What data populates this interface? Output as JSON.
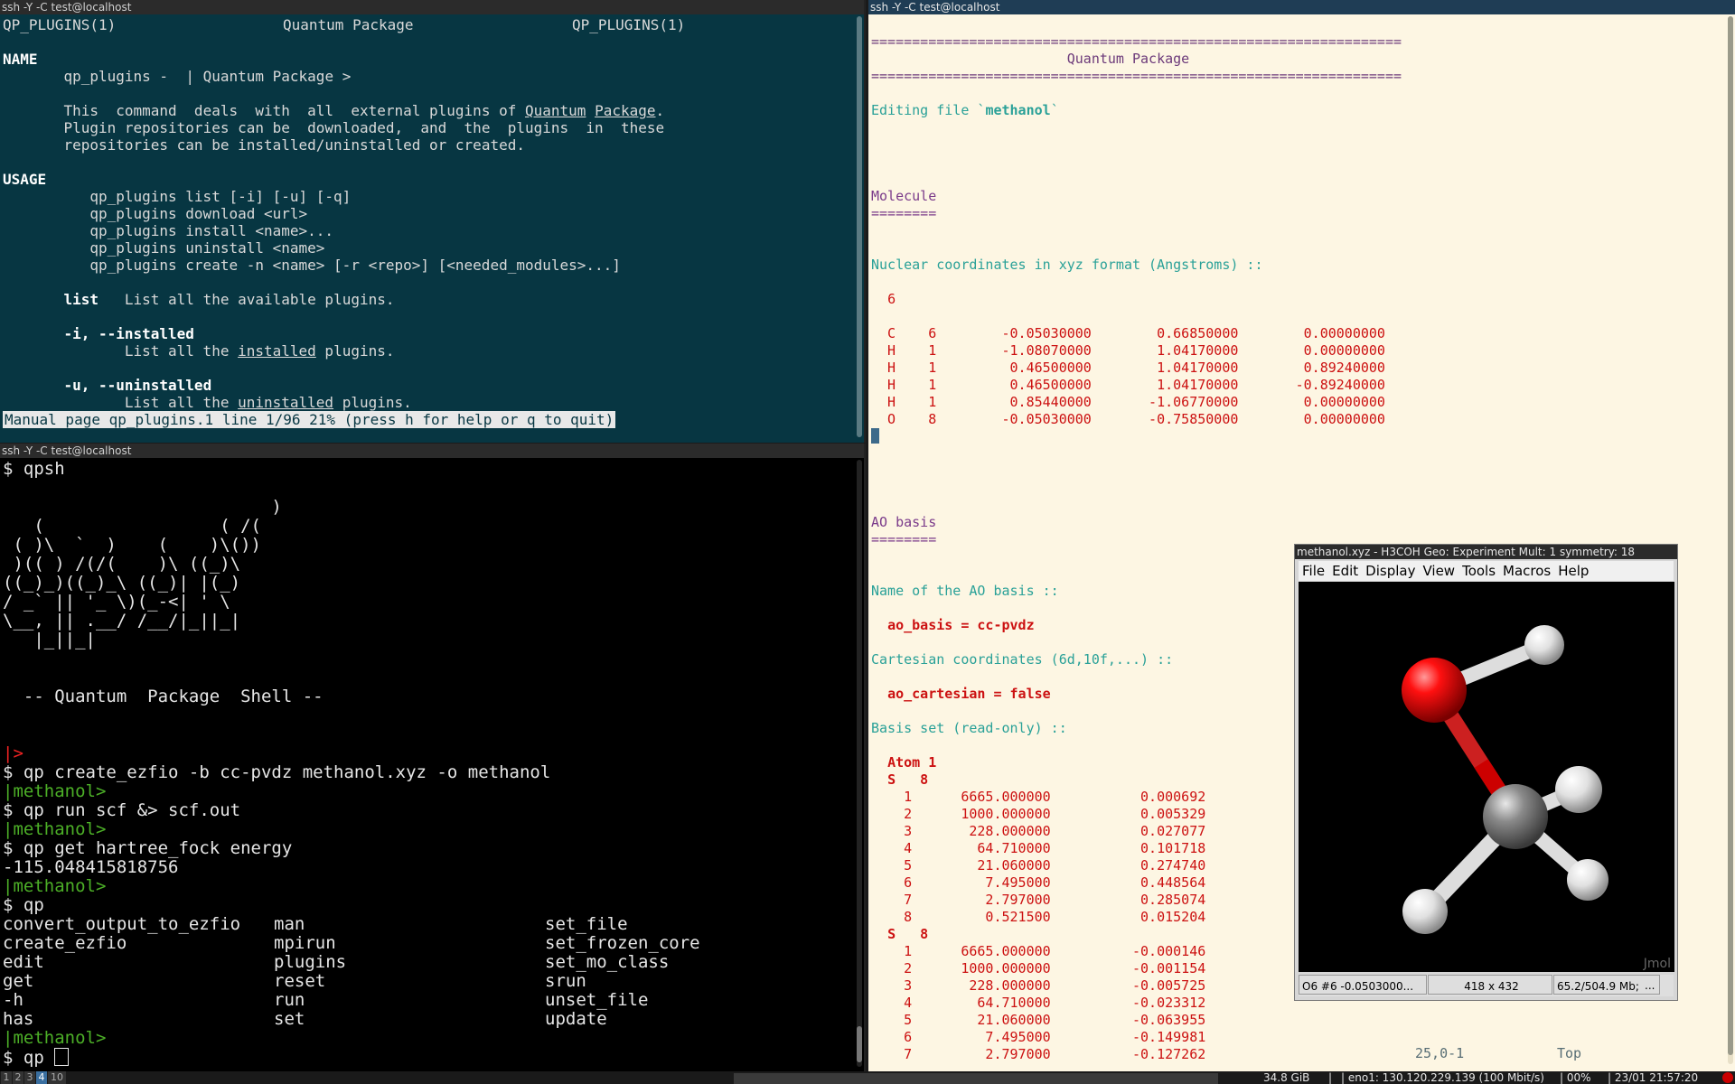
{
  "man_pane": {
    "title": "ssh -Y -C test@localhost",
    "header_left": "QP_PLUGINS(1)",
    "header_center": "Quantum Package",
    "header_right": "QP_PLUGINS(1)",
    "name_heading": "NAME",
    "name_prefix": "qp_plugins - ",
    "name_suffix": "| Quantum Package >",
    "desc_1a": "This  command  deals  with  all  external plugins of ",
    "desc_1b": "Quantum",
    "desc_1c": " ",
    "desc_1d": "Package",
    "desc_1e": ".",
    "desc_2": "Plugin repositories can be  downloaded,  and  the  plugins  in  these",
    "desc_3": "repositories can be installed/uninstalled or created.",
    "usage_heading": "USAGE",
    "usage_lines": [
      "qp_plugins list [-i] [-u] [-q]",
      "qp_plugins download <url>",
      "qp_plugins install <name>...",
      "qp_plugins uninstall <name>",
      "qp_plugins create -n <name> [-r <repo>] [<needed_modules>...]"
    ],
    "list_term": "list",
    "list_desc": "List all the available plugins.",
    "installed_term": "-i, --installed",
    "installed_desc_a": "List all the ",
    "installed_desc_b": "installed",
    "installed_desc_c": " plugins.",
    "uninstalled_term": "-u, --uninstalled",
    "uninstalled_desc_a": "List all the ",
    "uninstalled_desc_b": "uninstalled",
    "uninstalled_desc_c": " plugins.",
    "status": "Manual page qp_plugins.1 line 1/96 21% (press h for help or q to quit)"
  },
  "shell_pane": {
    "title": "ssh -Y -C test@localhost",
    "cmd_qpsh": "$ qpsh",
    "art": [
      "                          )",
      "   (                 ( /(",
      " ( )\\  `  )    (    )\\())",
      " )(( ) /(/(    )\\ ((_)\\",
      "((_)_)((_)_\\ ((_)| |(_)",
      "/ _` || '_ \\)(_-<| ' \\",
      "\\__, || .__/ /__/|_||_|",
      "   |_||_|"
    ],
    "banner": "  -- Quantum  Package  Shell --",
    "first_prompt": "|>",
    "lines": [
      {
        "kind": "cmd",
        "text": "$ qp create_ezfio -b cc-pvdz methanol.xyz -o methanol"
      },
      {
        "kind": "prompt",
        "text": "|methanol>"
      },
      {
        "kind": "cmd",
        "text": "$ qp run scf &> scf.out"
      },
      {
        "kind": "prompt",
        "text": "|methanol>"
      },
      {
        "kind": "cmd",
        "text": "$ qp get hartree_fock energy"
      },
      {
        "kind": "out",
        "text": "-115.048415818756"
      },
      {
        "kind": "prompt",
        "text": "|methanol>"
      },
      {
        "kind": "cmd",
        "text": "$ qp"
      }
    ],
    "completions": [
      [
        "convert_output_to_ezfio",
        "man",
        "set_file"
      ],
      [
        "create_ezfio",
        "mpirun",
        "set_frozen_core"
      ],
      [
        "edit",
        "plugins",
        "set_mo_class"
      ],
      [
        "get",
        "reset",
        "srun"
      ],
      [
        "-h",
        "run",
        "unset_file"
      ],
      [
        "has",
        "set",
        "update"
      ]
    ],
    "last_prompt": "|methanol>",
    "current_input": "$ qp "
  },
  "editor_pane": {
    "title": "ssh -Y -C test@localhost",
    "rule": "=================================================================",
    "heading": "Quantum Package",
    "editing_prefix": "Editing file `",
    "editing_file": "methanol",
    "editing_suffix": "`",
    "molecule_heading": "Molecule",
    "molecule_rule": "========",
    "coords_label": "Nuclear coordinates in xyz format (Angstroms) ::",
    "natoms": "6",
    "atoms": [
      [
        "C",
        "6",
        "-0.05030000",
        "0.66850000",
        "0.00000000"
      ],
      [
        "H",
        "1",
        "-1.08070000",
        "1.04170000",
        "0.00000000"
      ],
      [
        "H",
        "1",
        "0.46500000",
        "1.04170000",
        "0.89240000"
      ],
      [
        "H",
        "1",
        "0.46500000",
        "1.04170000",
        "-0.89240000"
      ],
      [
        "H",
        "1",
        "0.85440000",
        "-1.06770000",
        "0.00000000"
      ],
      [
        "O",
        "8",
        "-0.05030000",
        "-0.75850000",
        "0.00000000"
      ]
    ],
    "ao_heading": "AO basis",
    "ao_rule": "========",
    "ao_name_label": "Name of the AO basis ::",
    "ao_basis_value": "ao_basis = cc-pvdz",
    "cart_label": "Cartesian coordinates (6d,10f,...) ::",
    "ao_cart_value": "ao_cartesian = false",
    "basis_label": "Basis set (read-only) ::",
    "atom1": "Atom 1",
    "shell1_header": "S   8",
    "shell1": [
      [
        "1",
        "6665.000000",
        "0.000692"
      ],
      [
        "2",
        "1000.000000",
        "0.005329"
      ],
      [
        "3",
        "228.000000",
        "0.027077"
      ],
      [
        "4",
        "64.710000",
        "0.101718"
      ],
      [
        "5",
        "21.060000",
        "0.274740"
      ],
      [
        "6",
        "7.495000",
        "0.448564"
      ],
      [
        "7",
        "2.797000",
        "0.285074"
      ],
      [
        "8",
        "0.521500",
        "0.015204"
      ]
    ],
    "shell2_header": "S   8",
    "shell2": [
      [
        "1",
        "6665.000000",
        "-0.000146"
      ],
      [
        "2",
        "1000.000000",
        "-0.001154"
      ],
      [
        "3",
        "228.000000",
        "-0.005725"
      ],
      [
        "4",
        "64.710000",
        "-0.023312"
      ],
      [
        "5",
        "21.060000",
        "-0.063955"
      ],
      [
        "6",
        "7.495000",
        "-0.149981"
      ],
      [
        "7",
        "2.797000",
        "-0.127262"
      ]
    ],
    "cursor_pos": "25,0-1",
    "scroll_pos": "Top"
  },
  "jmol": {
    "title": "methanol.xyz - H3COH Geo: Experiment Mult: 1 symmetry: 18",
    "menu": [
      "File",
      "Edit",
      "Display",
      "View",
      "Tools",
      "Macros",
      "Help"
    ],
    "watermark": "Jmol",
    "status_atom": "O6 #6 -0.0503000...",
    "status_size": "418 x 432",
    "status_mem": "65.2/504.9 Mb;",
    "status_more": "..."
  },
  "taskbar": {
    "workspaces": [
      "1",
      "2",
      "3",
      "4",
      "10"
    ],
    "active_workspace": "4",
    "disk": "34.8 GiB",
    "sep": "|",
    "net": "| eno1: 130.120.229.139 (100 Mbit/s)",
    "cpu": "| 00%",
    "clock": "| 23/01 21:57:20",
    "colors": {
      "active_ws": "#3a6fa0",
      "alert": "#cc0000"
    }
  }
}
